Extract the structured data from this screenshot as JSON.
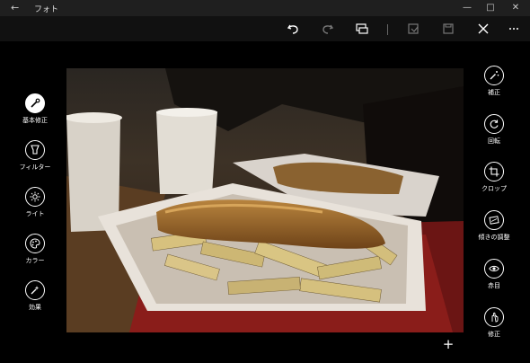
{
  "window": {
    "title": "フォト",
    "back_icon": "back-arrow-icon"
  },
  "toolbar": {
    "icons": [
      "undo-icon",
      "redo-icon",
      "compare-icon",
      "save-copy-icon",
      "save-icon",
      "close-icon",
      "more-icon"
    ]
  },
  "left_tools": [
    {
      "label": "基本修正",
      "icon": "magic-wand-icon",
      "active": true
    },
    {
      "label": "フィルター",
      "icon": "filter-icon"
    },
    {
      "label": "ライト",
      "icon": "light-icon"
    },
    {
      "label": "カラー",
      "icon": "palette-icon"
    },
    {
      "label": "効果",
      "icon": "effects-icon"
    }
  ],
  "right_tools": [
    {
      "label": "補正",
      "icon": "enhance-icon"
    },
    {
      "label": "回転",
      "icon": "rotate-icon"
    },
    {
      "label": "クロップ",
      "icon": "crop-icon"
    },
    {
      "label": "傾きの調整",
      "icon": "straighten-icon"
    },
    {
      "label": "赤目",
      "icon": "red-eye-icon"
    },
    {
      "label": "修正",
      "icon": "spot-fix-icon"
    }
  ],
  "add_label": "+"
}
